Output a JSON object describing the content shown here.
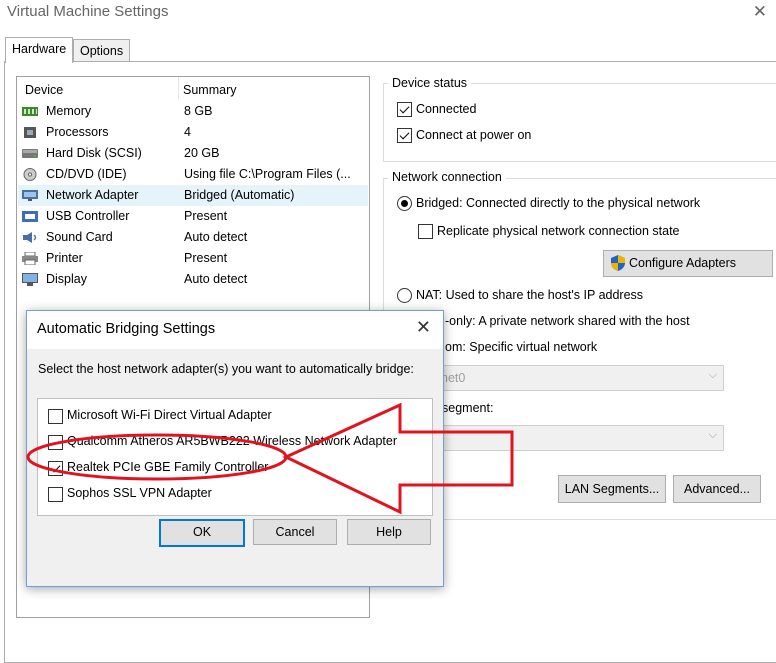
{
  "window": {
    "title": "Virtual Machine Settings"
  },
  "tabs": [
    {
      "label": "Hardware"
    },
    {
      "label": "Options"
    }
  ],
  "device_list": {
    "columns": {
      "device": "Device",
      "summary": "Summary"
    },
    "rows": [
      {
        "device": "Memory",
        "summary": "8 GB",
        "icon": "memory-icon"
      },
      {
        "device": "Processors",
        "summary": "4",
        "icon": "processor-icon"
      },
      {
        "device": "Hard Disk (SCSI)",
        "summary": "20 GB",
        "icon": "hard-disk-icon"
      },
      {
        "device": "CD/DVD (IDE)",
        "summary": "Using file C:\\Program Files (...",
        "icon": "cd-dvd-icon"
      },
      {
        "device": "Network Adapter",
        "summary": "Bridged (Automatic)",
        "icon": "network-adapter-icon",
        "selected": true
      },
      {
        "device": "USB Controller",
        "summary": "Present",
        "icon": "usb-icon"
      },
      {
        "device": "Sound Card",
        "summary": "Auto detect",
        "icon": "sound-card-icon"
      },
      {
        "device": "Printer",
        "summary": "Present",
        "icon": "printer-icon"
      },
      {
        "device": "Display",
        "summary": "Auto detect",
        "icon": "display-icon"
      }
    ]
  },
  "device_status": {
    "label": "Device status",
    "connected": {
      "label": "Connected",
      "checked": true
    },
    "connect_at_power_on": {
      "label": "Connect at power on",
      "checked": true
    }
  },
  "network_connection": {
    "label": "Network connection",
    "bridged": {
      "label": "Bridged: Connected directly to the physical network",
      "selected": true
    },
    "replicate": {
      "label": "Replicate physical network connection state",
      "checked": false
    },
    "configure_adapters": "Configure Adapters",
    "nat": {
      "label": "NAT: Used to share the host's IP address"
    },
    "host_only_partial": "-only: A private network shared with the host",
    "custom_partial": "om: Specific virtual network",
    "vmnet_partial": "net0",
    "lan_segment_partial": "segment:",
    "lan_segments_button": "LAN Segments...",
    "advanced_button": "Advanced..."
  },
  "dialog": {
    "title": "Automatic Bridging Settings",
    "instruction": "Select the host network adapter(s) you want to automatically bridge:",
    "adapters": [
      {
        "label": "Microsoft Wi-Fi Direct Virtual Adapter",
        "checked": false
      },
      {
        "label": "Qualcomm Atheros AR5BWB222 Wireless Network Adapter",
        "checked": false
      },
      {
        "label": "Realtek PCIe GBE Family Controller",
        "checked": true
      },
      {
        "label": "Sophos SSL VPN Adapter",
        "checked": false
      }
    ],
    "ok": "OK",
    "cancel": "Cancel",
    "help": "Help"
  },
  "annotation_color": "#e0141e"
}
